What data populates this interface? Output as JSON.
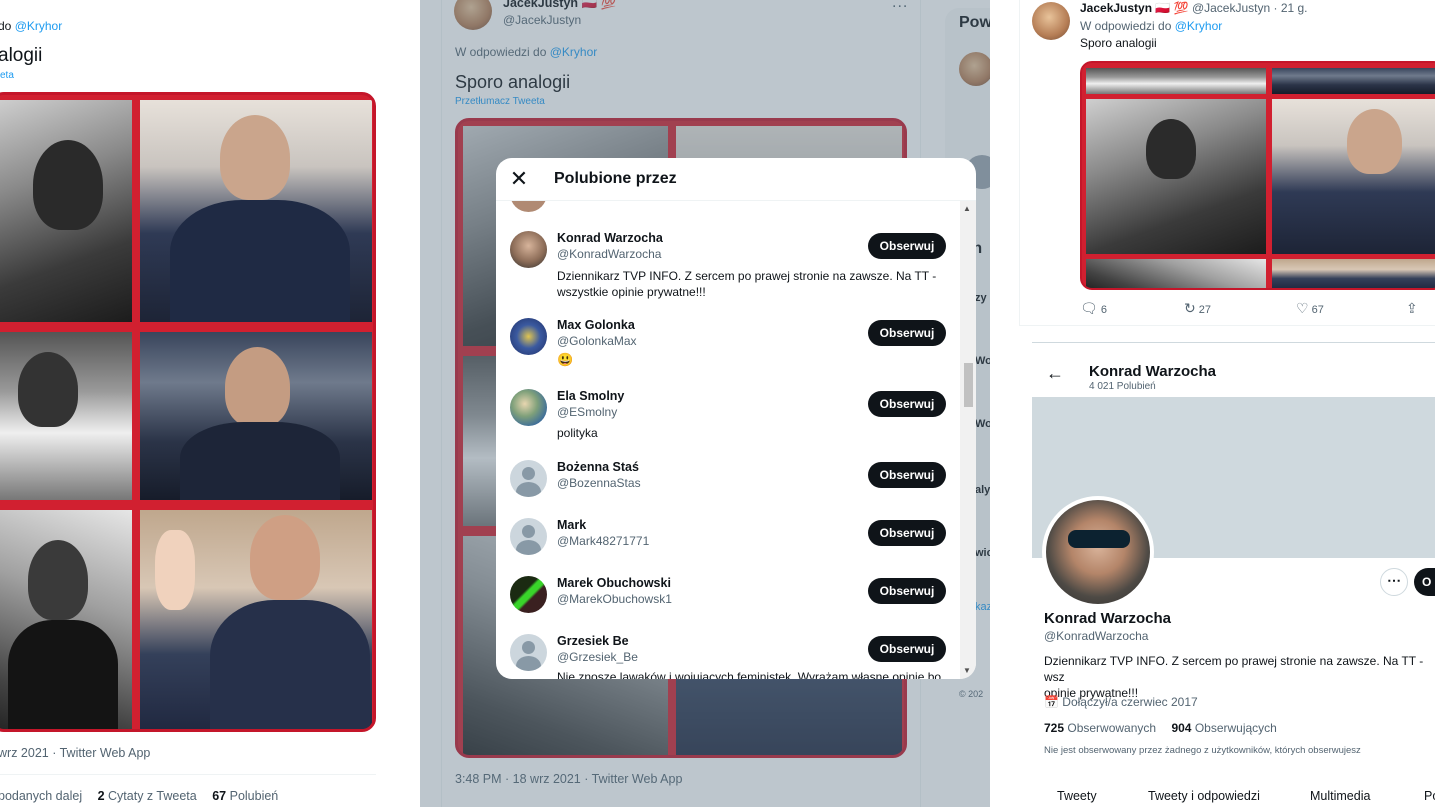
{
  "panel1": {
    "reply_to_prefix": "do",
    "reply_to_handle": "@Kryhor",
    "tweet_text": "alogii",
    "translate_link": "eta",
    "timestamp": "wrz 2021 · Twitter Web App",
    "stats": {
      "retweets_label": "podanych dalej",
      "quotes_count": "2",
      "quotes_label": "Cytaty z Tweeta",
      "likes_count": "67",
      "likes_label": "Polubień"
    }
  },
  "panel2": {
    "author_name": "JacekJustyn 🇵🇱 💯",
    "author_handle": "@JacekJustyn",
    "more_icon": "...",
    "reply_to_prefix": "W odpowiedzi do",
    "reply_to_handle": "@Kryhor",
    "tweet_text": "Sporo analogii",
    "translate_link": "Przetłumacz Tweeta",
    "timestamp": "3:48 PM · 18 wrz 2021 · Twitter Web App",
    "sidebar_title": "Pow",
    "sidebar_fragments": [
      "ajn",
      "zy",
      "Wor",
      "Wor",
      "aly",
      "wic",
      "kaz"
    ],
    "sidebar_footer": "© 202",
    "modal": {
      "title": "Polubione przez",
      "close_icon": "close-icon",
      "follow_label": "Obserwuj",
      "users": [
        {
          "name": "Konrad Warzocha",
          "handle": "@KonradWarzocha",
          "bio": "Dziennikarz TVP INFO. Z sercem po prawej stronie na zawsze. Na TT -\nwszystkie opinie prywatne!!!"
        },
        {
          "name": "Max Golonka",
          "handle": "@GolonkaMax",
          "bio": "😃"
        },
        {
          "name": "Ela Smolny",
          "handle": "@ESmolny",
          "bio": "polityka"
        },
        {
          "name": "Bożenna Staś",
          "handle": "@BozennaStas",
          "bio": ""
        },
        {
          "name": "Mark",
          "handle": "@Mark48271771",
          "bio": ""
        },
        {
          "name": "Marek Obuchowski",
          "handle": "@MarekObuchowsk1",
          "bio": ""
        },
        {
          "name": "Grzesiek Be",
          "handle": "@Grzesiek_Be",
          "bio": "Nie znoszę lawaków i wojujących feministek. Wyrażam własne opinie bo"
        }
      ]
    }
  },
  "panel3": {
    "author_name": "JacekJustyn 🇵🇱 💯",
    "author_handle": "@JacekJustyn · 21 g.",
    "reply_to_prefix": "W odpowiedzi do",
    "reply_to_handle": "@Kryhor",
    "tweet_text": "Sporo analogii",
    "actions": {
      "replies": "6",
      "retweets": "27",
      "likes": "67"
    },
    "profile": {
      "header_name": "Konrad Warzocha",
      "header_likes": "4 021 Polubień",
      "name": "Konrad Warzocha",
      "handle": "@KonradWarzocha",
      "bio": "Dziennikarz TVP INFO. Z sercem po prawej stronie na zawsze. Na TT - wsz\nopinie prywatne!!!",
      "joined": "Dołączył/a czerwiec 2017",
      "following_count": "725",
      "following_label": "Obserwowanych",
      "followers_count": "904",
      "followers_label": "Obserwujących",
      "not_followed_note": "Nie jest obserwowany przez żadnego z użytkowników, których obserwujesz",
      "follow_button_fragment": "O",
      "tabs": [
        "Tweety",
        "Tweety i odpowiedzi",
        "Multimedia",
        "Po"
      ]
    }
  },
  "colors": {
    "accent": "#1d9bf0",
    "collage_border": "#c4162a",
    "follow_button": "#0f1419",
    "overlay": "rgba(91,112,131,0.4)"
  }
}
